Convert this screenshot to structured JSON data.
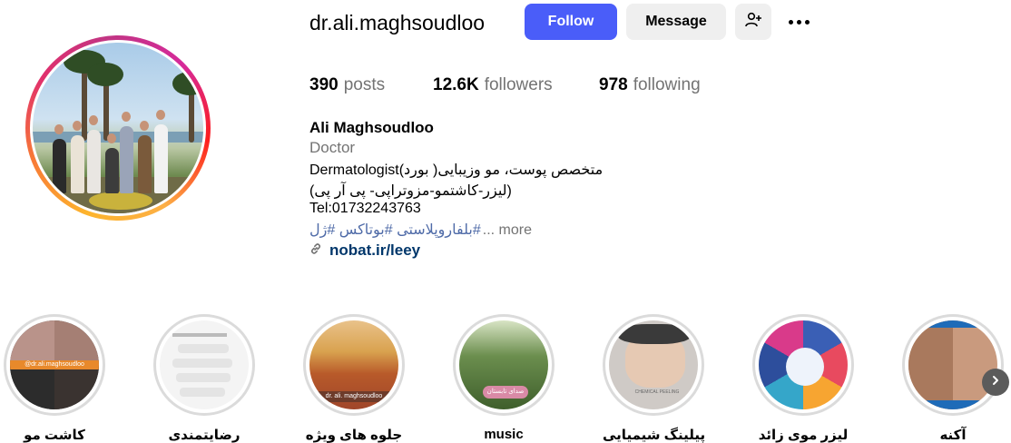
{
  "profile": {
    "username": "dr.ali.maghsoudloo",
    "follow_label": "Follow",
    "message_label": "Message",
    "add_user_icon": "person-add-icon",
    "more_icon": "more-horizontal-icon"
  },
  "stats": {
    "posts_count": "390",
    "posts_label": "posts",
    "followers_count": "12.6K",
    "followers_label": "followers",
    "following_count": "978",
    "following_label": "following"
  },
  "bio": {
    "name": "Ali Maghsoudloo",
    "category": "Doctor",
    "line1": "Dermatologist(متخصص پوست، مو وزیبایی( بورد",
    "line2": "(لیزر-کاشتمو-مزوتراپی- پی آر پی)",
    "line3": "Tel:01732243763",
    "hashtags": "#بلفاروپلاستی #بوتاکس #ژل",
    "more_label": "... more",
    "link": "nobat.ir/leey",
    "link_icon": "link-icon"
  },
  "highlights": [
    {
      "label": "کاشت مو"
    },
    {
      "label": "رضایتمندی"
    },
    {
      "label": "جلوه های ویژه"
    },
    {
      "label": "music"
    },
    {
      "label": "پیلینگ شیمیایی"
    },
    {
      "label": "لیزر موی زائد"
    },
    {
      "label": "آکنه"
    }
  ],
  "highlight_overlays": {
    "hair_tag": "@dr.ali.maghsoudloo",
    "effects_tag": "dr. ali. maghsoudloo",
    "music_tag": "صدای تابستان",
    "peeling_tag": "CHEMICAL PEELING"
  },
  "next_icon": "chevron-right-icon",
  "colors": {
    "follow_bg": "#4a5df9",
    "secondary_bg": "#efefef",
    "link": "#00376b",
    "hashtag": "#4f6ba8",
    "muted": "#737373"
  }
}
